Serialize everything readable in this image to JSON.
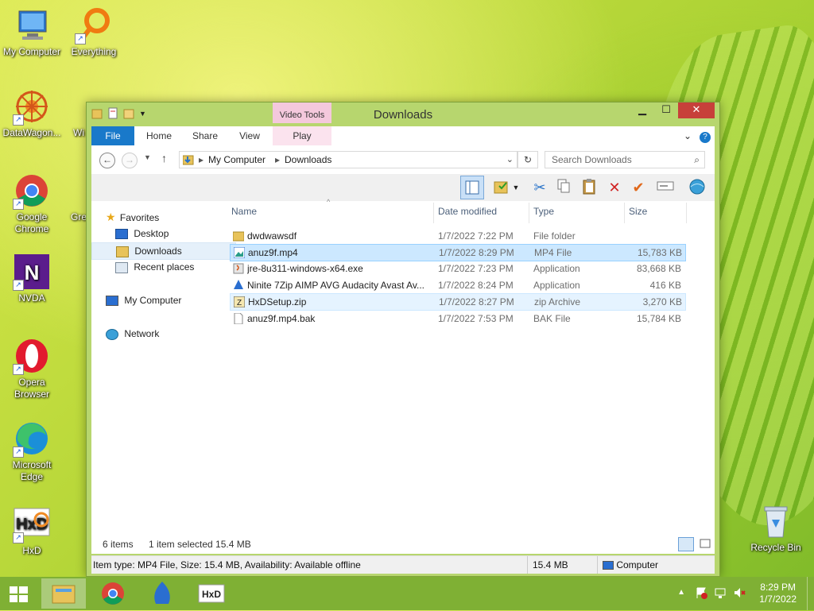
{
  "desktop": {
    "icons": [
      {
        "label": "My Computer",
        "icon": "monitor-icon"
      },
      {
        "label": "Everything",
        "icon": "magnifier-icon"
      },
      {
        "label": "DataWagon...",
        "icon": "datawagon-icon"
      },
      {
        "label": "Google Chrome",
        "icon": "chrome-icon"
      },
      {
        "label": "NVDA",
        "icon": "nvda-icon"
      },
      {
        "label": "Opera Browser",
        "icon": "opera-icon"
      },
      {
        "label": "Microsoft Edge",
        "icon": "edge-icon"
      },
      {
        "label": "HxD",
        "icon": "hxd-icon"
      },
      {
        "label": "Recycle Bin",
        "icon": "recycle-bin-icon"
      }
    ],
    "partial_labels": [
      "Wi",
      "Gre"
    ]
  },
  "window": {
    "title": "Downloads",
    "context_tab": {
      "group": "Video Tools",
      "label": "Play"
    },
    "ribbon_tabs": [
      "File",
      "Home",
      "Share",
      "View"
    ],
    "address": {
      "crumbs": [
        "My Computer",
        "Downloads"
      ]
    },
    "search_placeholder": "Search Downloads",
    "nav": {
      "favorites": "Favorites",
      "desktop": "Desktop",
      "downloads": "Downloads",
      "recent": "Recent places",
      "computer": "My Computer",
      "network": "Network"
    },
    "columns": [
      "Name",
      "Date modified",
      "Type",
      "Size"
    ],
    "files": [
      {
        "name": "dwdwawsdf",
        "date": "1/7/2022 7:22 PM",
        "type": "File folder",
        "size": "",
        "icon": "folder-icon"
      },
      {
        "name": "anuz9f.mp4",
        "date": "1/7/2022 8:29 PM",
        "type": "MP4 File",
        "size": "15,783 KB",
        "icon": "video-file-icon"
      },
      {
        "name": "jre-8u311-windows-x64.exe",
        "date": "1/7/2022 7:23 PM",
        "type": "Application",
        "size": "83,668 KB",
        "icon": "java-installer-icon"
      },
      {
        "name": "Ninite 7Zip AIMP AVG Audacity Avast Av...",
        "date": "1/7/2022 8:24 PM",
        "type": "Application",
        "size": "416 KB",
        "icon": "ninite-icon"
      },
      {
        "name": "HxDSetup.zip",
        "date": "1/7/2022 8:27 PM",
        "type": "zip Archive",
        "size": "3,270 KB",
        "icon": "zip-file-icon"
      },
      {
        "name": "anuz9f.mp4.bak",
        "date": "1/7/2022 7:53 PM",
        "type": "BAK File",
        "size": "15,784 KB",
        "icon": "blank-file-icon"
      }
    ],
    "status": {
      "count": "6 items",
      "selected": "1 item selected  15.4 MB"
    },
    "details": {
      "info": "Item type: MP4 File, Size: 15.4 MB, Availability: Available offline",
      "size": "15.4 MB",
      "location": "Computer"
    }
  },
  "taskbar": {
    "clock_time": "8:29 PM",
    "clock_date": "1/7/2022"
  }
}
